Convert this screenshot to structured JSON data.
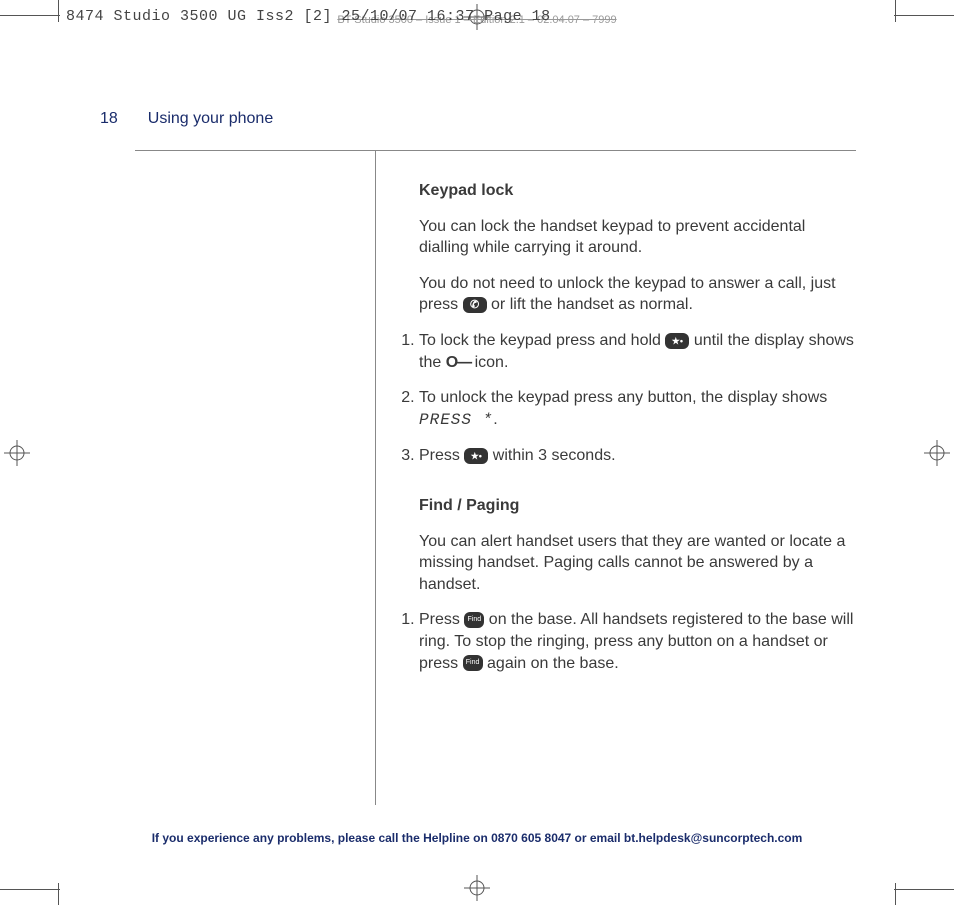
{
  "proof_header": "8474 Studio 3500 UG Iss2 [2]  25/10/07  16:37  Page 18",
  "bg_header": "BT Studio 3500 – Issue 1 – Edition 2.1 – 02.04.07 – 7999",
  "page_number": "18",
  "section_title": "Using your phone",
  "keypad": {
    "heading": "Keypad lock",
    "intro1": "You can lock the handset keypad to prevent accidental dialling while carrying it around.",
    "intro2a": "You do not need to unlock the keypad to answer a call, just press ",
    "intro2b": " or lift the handset as normal.",
    "step1a": "To lock the keypad press and hold ",
    "step1b": " until the display shows the ",
    "step1c": " icon.",
    "step2a": "To unlock the keypad press any button, the display shows ",
    "step2_lcd": "PRESS *",
    "step2b": ".",
    "step3a": "Press ",
    "step3b": " within 3 seconds."
  },
  "paging": {
    "heading": "Find / Paging",
    "intro": "You can alert handset users that they are wanted or locate a missing handset. Paging calls cannot be answered by a handset.",
    "step1a": "Press ",
    "step1b": " on the base. All handsets registered to the base will ring. To stop the ringing, press any button on a handset or press ",
    "step1c": " again on the base."
  },
  "footer": "If you experience any problems, please call the Helpline on 0870 605 8047 or email bt.helpdesk@suncorptech.com",
  "icons": {
    "lock": "O—"
  }
}
